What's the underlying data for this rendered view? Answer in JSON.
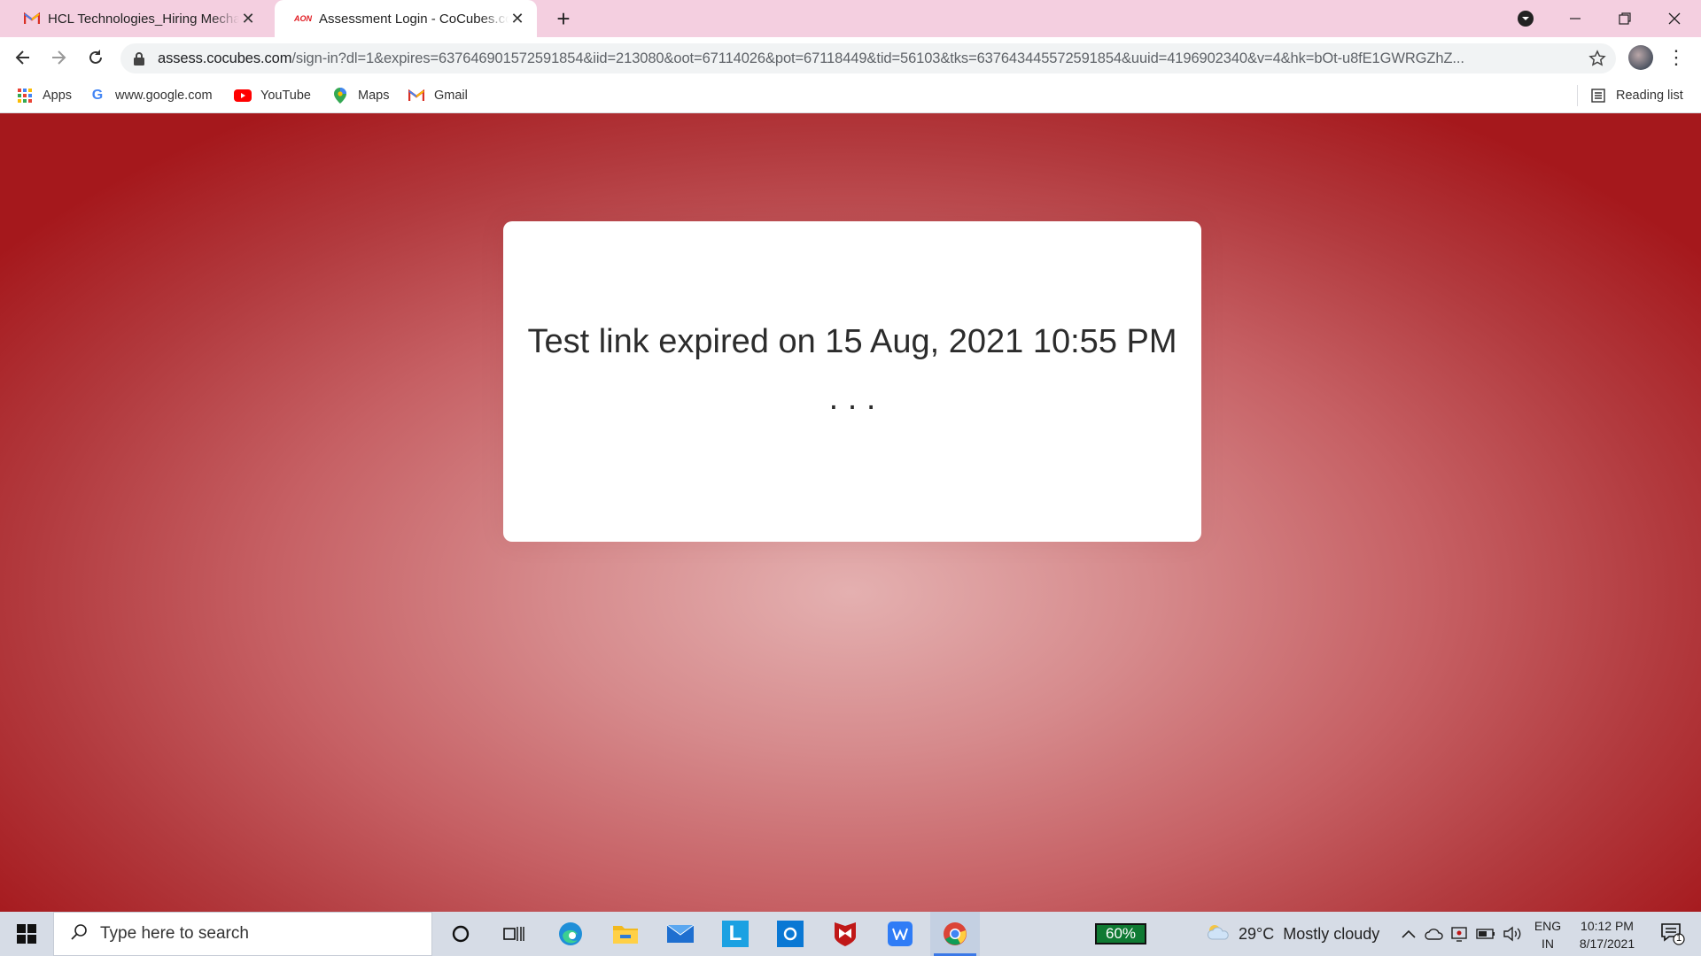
{
  "browser": {
    "tabs": [
      {
        "title": "HCL Technologies_Hiring Mechanical",
        "favicon": "gmail-icon",
        "active": false
      },
      {
        "title": "Assessment Login - CoCubes.com",
        "favicon": "aon-icon",
        "favicon_text": "AON",
        "active": true
      }
    ],
    "url_host": "assess.cocubes.com",
    "url_rest": "/sign-in?dl=1&expires=637646901572591854&iid=213080&oot=67114026&pot=67118449&tid=56103&tks=637643445572591854&uuid=4196902340&v=4&hk=bOt-u8fE1GWRGZhZ...",
    "bookmarks": [
      {
        "label": "Apps",
        "icon": "apps-grid-icon"
      },
      {
        "label": "www.google.com",
        "icon": "google-icon"
      },
      {
        "label": "YouTube",
        "icon": "youtube-icon"
      },
      {
        "label": "Maps",
        "icon": "maps-pin-icon"
      },
      {
        "label": "Gmail",
        "icon": "gmail-icon"
      }
    ],
    "reading_list": "Reading list"
  },
  "page": {
    "message": "Test link expired on 15 Aug, 2021 10:55 PM . . ."
  },
  "taskbar": {
    "search_placeholder": "Type here to search",
    "battery_percent": "60%",
    "weather_temp": "29°C",
    "weather_desc": "Mostly cloudy",
    "lang_line1": "ENG",
    "lang_line2": "IN",
    "time": "10:12 PM",
    "date": "8/17/2021",
    "notification_count": "1"
  },
  "colors": {
    "tabstrip": "#f4cfe0",
    "page_edge": "#a5181c",
    "page_center": "#e4b0b0",
    "taskbar": "#d6dce6"
  }
}
